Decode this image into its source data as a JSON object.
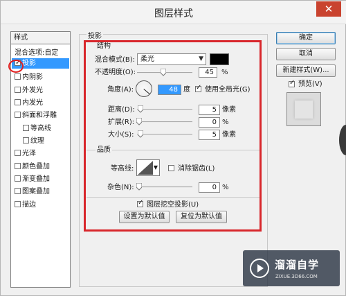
{
  "window": {
    "title": "图层样式",
    "close_glyph": "✕"
  },
  "styles_panel": {
    "header": "样式",
    "items": [
      {
        "label": "混合选项:自定",
        "checkbox": false,
        "checked": false,
        "selected": false
      },
      {
        "label": "投影",
        "checkbox": true,
        "checked": true,
        "selected": true
      },
      {
        "label": "内阴影",
        "checkbox": true,
        "checked": false,
        "selected": false
      },
      {
        "label": "外发光",
        "checkbox": true,
        "checked": false,
        "selected": false
      },
      {
        "label": "内发光",
        "checkbox": true,
        "checked": false,
        "selected": false
      },
      {
        "label": "斜面和浮雕",
        "checkbox": true,
        "checked": false,
        "selected": false
      },
      {
        "label": "等高线",
        "checkbox": true,
        "checked": false,
        "selected": false
      },
      {
        "label": "纹理",
        "checkbox": true,
        "checked": false,
        "selected": false
      },
      {
        "label": "光泽",
        "checkbox": true,
        "checked": false,
        "selected": false
      },
      {
        "label": "颜色叠加",
        "checkbox": true,
        "checked": false,
        "selected": false
      },
      {
        "label": "渐变叠加",
        "checkbox": true,
        "checked": false,
        "selected": false
      },
      {
        "label": "图案叠加",
        "checkbox": true,
        "checked": false,
        "selected": false
      },
      {
        "label": "描边",
        "checkbox": true,
        "checked": false,
        "selected": false
      }
    ]
  },
  "drop_shadow": {
    "group_title": "投影",
    "structure": {
      "title": "结构",
      "blend_mode_label": "混合模式(B):",
      "blend_mode_value": "柔光",
      "opacity_label": "不透明度(O):",
      "opacity_value": "45",
      "opacity_unit": "%",
      "angle_label": "角度(A):",
      "angle_value": "48",
      "angle_unit": "度",
      "global_light_label": "使用全局光(G)",
      "global_light_checked": true,
      "distance_label": "距离(D):",
      "distance_value": "5",
      "distance_unit": "像素",
      "spread_label": "扩展(R):",
      "spread_value": "0",
      "spread_unit": "%",
      "size_label": "大小(S):",
      "size_value": "5",
      "size_unit": "像素"
    },
    "quality": {
      "title": "品质",
      "contour_label": "等高线:",
      "anti_alias_label": "消除锯齿(L)",
      "noise_label": "杂色(N):",
      "noise_value": "0",
      "noise_unit": "%"
    },
    "knockout_label": "图层挖空投影(U)",
    "make_default_label": "设置为默认值",
    "reset_default_label": "复位为默认值"
  },
  "buttons": {
    "ok": "确定",
    "cancel": "取消",
    "new_style": "新建样式(W)...",
    "preview_label": "预览(V)"
  },
  "watermark": {
    "cn": "溜溜自学",
    "en": "ZIXUE.3D66.COM"
  },
  "colors": {
    "selection": "#3399ff",
    "highlight_box": "#d8262b",
    "shadow_color": "#000000"
  }
}
